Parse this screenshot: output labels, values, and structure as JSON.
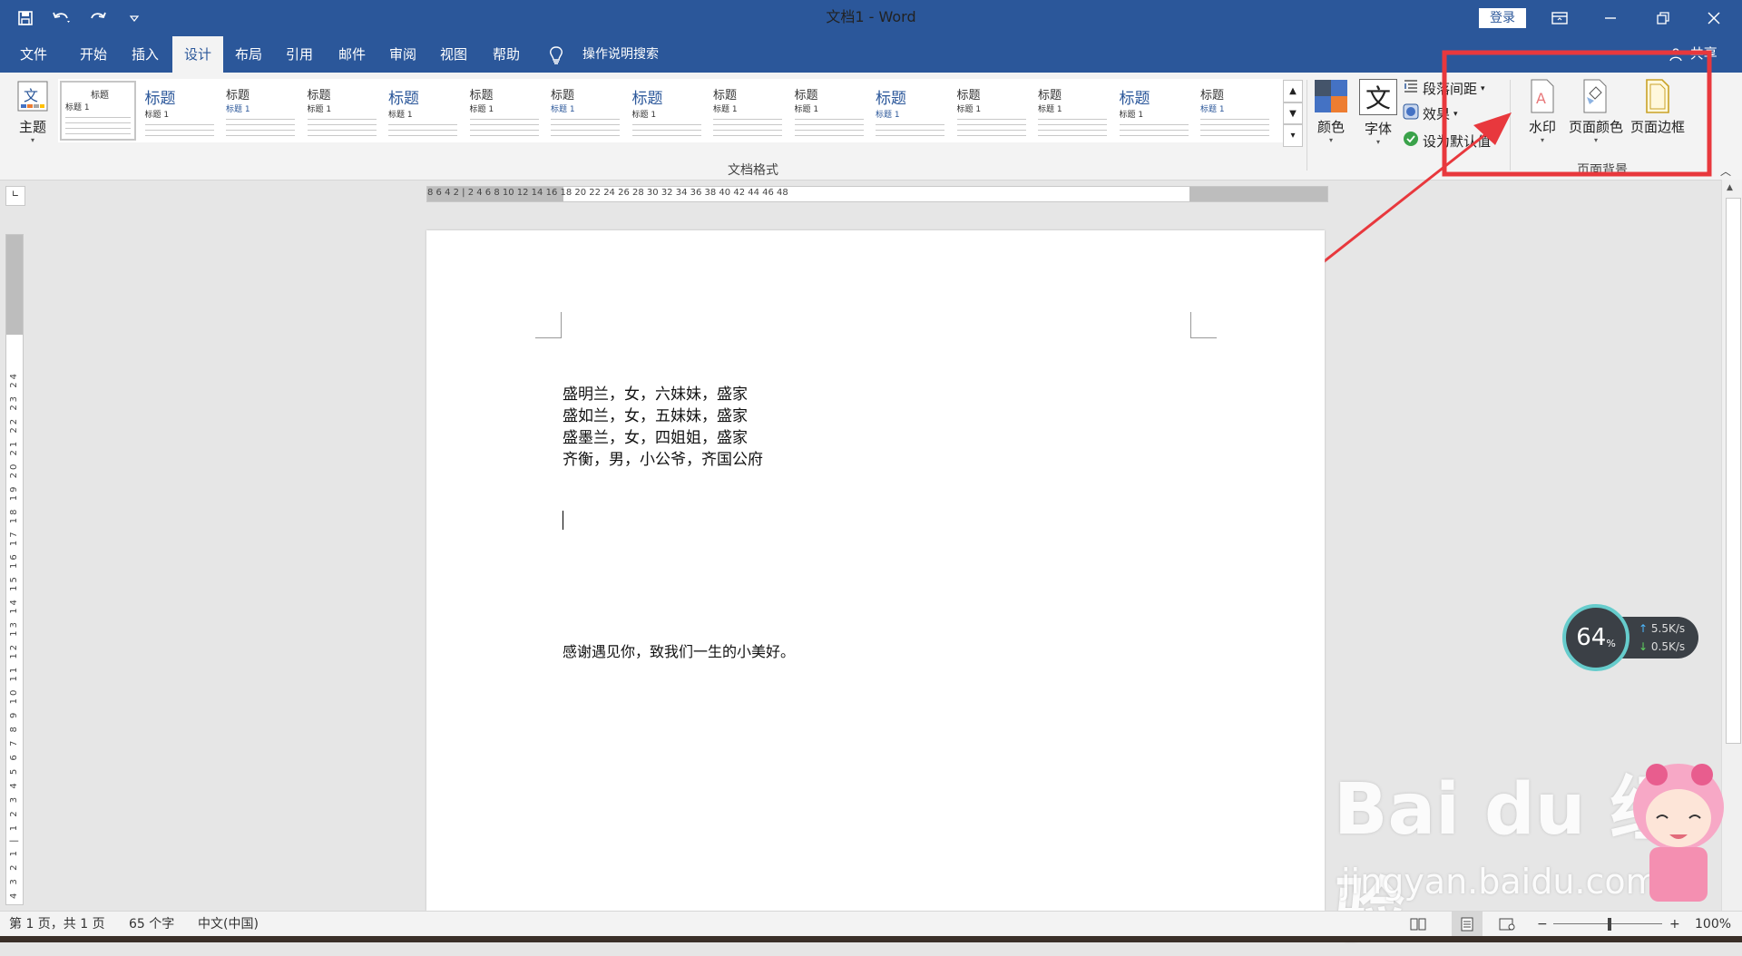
{
  "window": {
    "title": "文档1 - Word",
    "login_label": "登录"
  },
  "quick_access": {
    "icons": [
      "save-icon",
      "undo-icon",
      "redo-icon",
      "customize-icon"
    ]
  },
  "menu": {
    "items": [
      "文件",
      "开始",
      "插入",
      "设计",
      "布局",
      "引用",
      "邮件",
      "审阅",
      "视图",
      "帮助"
    ],
    "active": "设计",
    "search_label": "操作说明搜索",
    "share_label": "共享"
  },
  "ribbon": {
    "theme_label": "主题",
    "style_thumbnails": [
      {
        "heading": "标题",
        "sub": "标题 1"
      },
      {
        "heading": "标题",
        "sub": "标题 1"
      },
      {
        "heading": "标题",
        "sub": "标题 1"
      },
      {
        "heading": "标题",
        "sub": "标题 1"
      },
      {
        "heading": "标题",
        "sub": "标题 1"
      },
      {
        "heading": "标题",
        "sub": "标题 1"
      },
      {
        "heading": "标题",
        "sub": "标题 1"
      },
      {
        "heading": "标题",
        "sub": "标题 1"
      },
      {
        "heading": "标题",
        "sub": "标题 1"
      },
      {
        "heading": "标题",
        "sub": "标题 1"
      },
      {
        "heading": "标题",
        "sub": "标题 1"
      },
      {
        "heading": "标题",
        "sub": "标题 1"
      },
      {
        "heading": "标题",
        "sub": "标题 1"
      },
      {
        "heading": "标题",
        "sub": "标题 1"
      },
      {
        "heading": "标题",
        "sub": "标题 1"
      }
    ],
    "doc_format_group": "文档格式",
    "colors_label": "颜色",
    "fonts_label": "字体",
    "fonts_glyph": "文",
    "paragraph_spacing_label": "段落间距",
    "effects_label": "效果",
    "set_default_label": "设为默认值",
    "watermark_label": "水印",
    "page_color_label": "页面颜色",
    "page_borders_label": "页面边框",
    "page_background_group": "页面背景"
  },
  "ruler": {
    "horizontal_ticks": "8 6 4 2 | 2 4 6 8 10 12 14 16 18 20 22 24 26 28 30 32 34 36 38 40 42 44 46 48",
    "vertical_ticks": "4 3 2 1 | 1 2 3 4 5 6 7 8 9 10 11 12 13 14 15 16 17 18 19 20 21 22 23 24"
  },
  "document": {
    "lines": [
      "盛明兰，女，六妹妹，盛家",
      "盛如兰，女，五妹妹，盛家",
      "盛墨兰，女，四姐姐，盛家",
      "齐衡，男，小公爷，齐国公府"
    ],
    "footer_line": "感谢遇见你，致我们一生的小美好。"
  },
  "statusbar": {
    "page": "第 1 页，共 1 页",
    "words": "65 个字",
    "language": "中文(中国)",
    "zoom": "100%"
  },
  "overlay": {
    "speed_percent": "64",
    "speed_unit": "%",
    "upload": "5.5K/s",
    "download": "0.5K/s",
    "watermark_text": "Bai du 经验",
    "watermark_url": "jingyan.baidu.com"
  },
  "annotation_color": "#e8383d"
}
